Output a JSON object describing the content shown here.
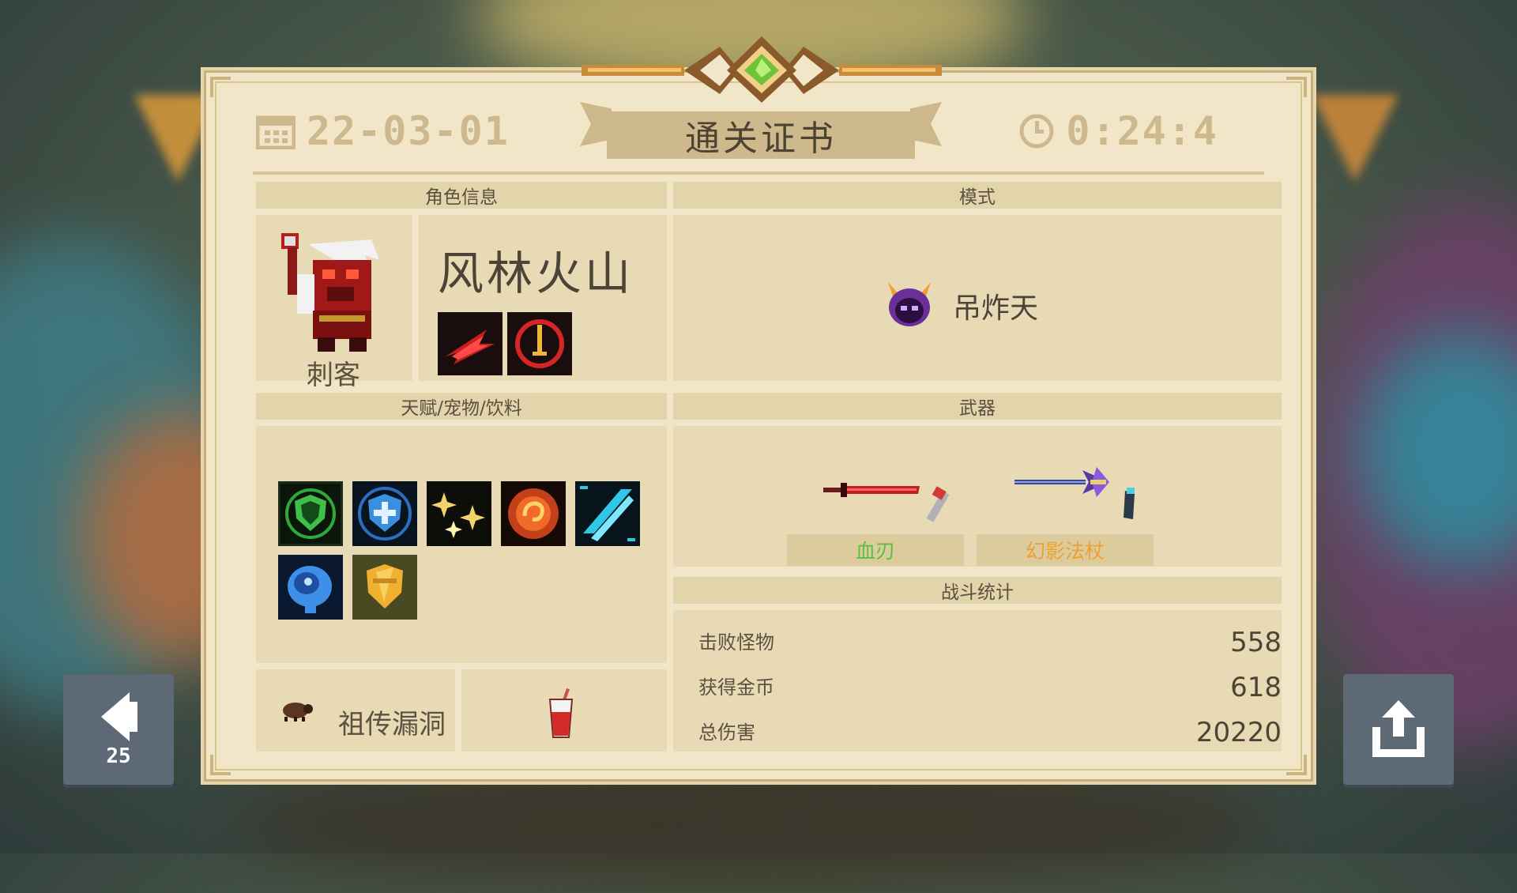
{
  "certificate": {
    "title": "通关证书",
    "date": "22-03-01",
    "time": "0:24:4"
  },
  "sections": {
    "character_info": "角色信息",
    "mode": "模式",
    "talents_pets_drinks": "天赋/宠物/饮料",
    "weapons": "武器",
    "battle_stats": "战斗统计"
  },
  "character": {
    "skin_name": "风林火山",
    "class_name": "刺客",
    "skills": [
      "dash-skill-icon",
      "sword-circle-skill-icon"
    ]
  },
  "mode": {
    "name": "吊炸天",
    "icon": "purple-demon-helmet-icon"
  },
  "talents": [
    "green-shield-icon",
    "blue-shield-cross-icon",
    "sparkle-burst-icon",
    "fire-swirl-icon",
    "cyan-slash-icon",
    "blue-brain-icon",
    "gold-shield-icon"
  ],
  "pet": {
    "name": "祖传漏洞",
    "icon": "bug-pet-icon"
  },
  "drink": {
    "icon": "red-drink-cup-icon"
  },
  "weapons": [
    {
      "name": "血刃",
      "color": "#58c23f",
      "icon": "blood-blade-icon"
    },
    {
      "name": "幻影法杖",
      "color": "#f0a030",
      "icon": "phantom-staff-icon"
    }
  ],
  "stats": [
    {
      "label": "击败怪物",
      "value": "558"
    },
    {
      "label": "获得金币",
      "value": "618"
    },
    {
      "label": "总伤害",
      "value": "20220"
    }
  ],
  "navigation": {
    "back_count": "25"
  },
  "colors": {
    "paper": "#f1e6c8",
    "header_band": "#e2d4ab",
    "title_plate": "#cdb98c",
    "button": "#5d6a76"
  }
}
